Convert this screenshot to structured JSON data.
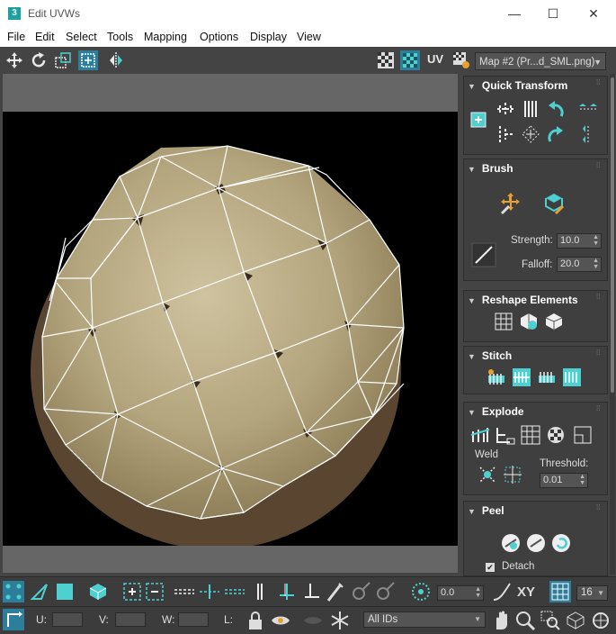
{
  "window": {
    "title": "Edit UVWs",
    "app_icon": "3"
  },
  "window_controls": {
    "minimize": "—",
    "maximize": "☐",
    "close": "✕"
  },
  "menu": [
    "File",
    "Edit",
    "Select",
    "Tools",
    "Mapping",
    "Options",
    "Display",
    "View"
  ],
  "toolbar": {
    "uv_label": "UV",
    "map_selector": "Map #2 (Pr...d_SML.png)"
  },
  "panel": {
    "quick_transform": {
      "title": "Quick Transform"
    },
    "brush": {
      "title": "Brush",
      "strength_label": "Strength:",
      "strength_value": "10.0",
      "falloff_label": "Falloff:",
      "falloff_value": "20.0"
    },
    "reshape": {
      "title": "Reshape Elements"
    },
    "stitch": {
      "title": "Stitch"
    },
    "explode": {
      "title": "Explode",
      "weld_label": "Weld",
      "threshold_label": "Threshold:",
      "threshold_value": "0.01"
    },
    "peel": {
      "title": "Peel",
      "detach_label": "Detach"
    }
  },
  "bottom": {
    "value_field": "0.0",
    "xy_label": "XY",
    "grid_value": "16",
    "u_label": "U:",
    "v_label": "V:",
    "w_label": "W:",
    "l_label": "L:",
    "ids_dropdown": "All IDs"
  },
  "colors": {
    "accent": "#4fd0d0",
    "panel_bg": "#3f3f3f",
    "texture": "#b6a982"
  }
}
